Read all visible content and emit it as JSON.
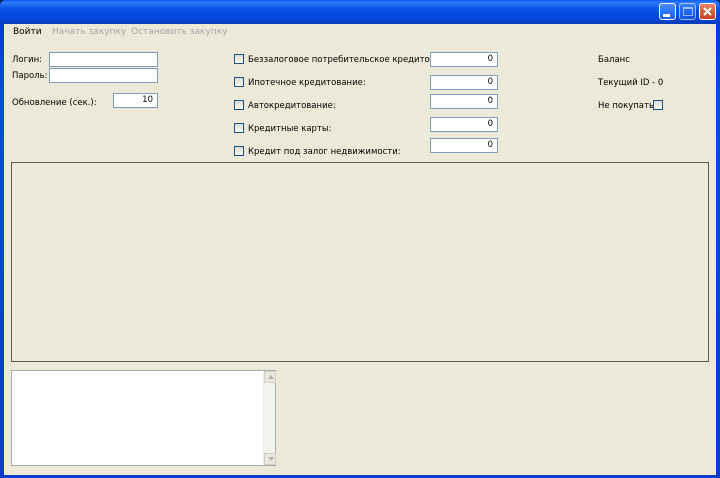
{
  "menu": {
    "login": "Войти",
    "start": "Начать закупку",
    "stop": "Остановить закупку"
  },
  "form": {
    "login_label": "Логин:",
    "password_label": "Пароль:",
    "refresh_label": "Обновление (сек.):",
    "refresh_value": "10"
  },
  "credit_types": [
    {
      "label": "Беззалоговое потребительское кредитование:",
      "value": "0",
      "checked": false
    },
    {
      "label": "Ипотечное кредитование:",
      "value": "0",
      "checked": false
    },
    {
      "label": "Автокредитование:",
      "value": "0",
      "checked": false
    },
    {
      "label": "Кредитные карты:",
      "value": "0",
      "checked": false
    },
    {
      "label": "Кредит под залог недвижимости:",
      "value": "0",
      "checked": false
    }
  ],
  "status": {
    "balance_label": "Баланс",
    "current_id_label": "Текущий ID - 0",
    "no_buy_label": "Не покупать:"
  },
  "icons": {
    "minimize": "minimize-icon",
    "maximize": "maximize-icon",
    "close": "close-icon"
  }
}
